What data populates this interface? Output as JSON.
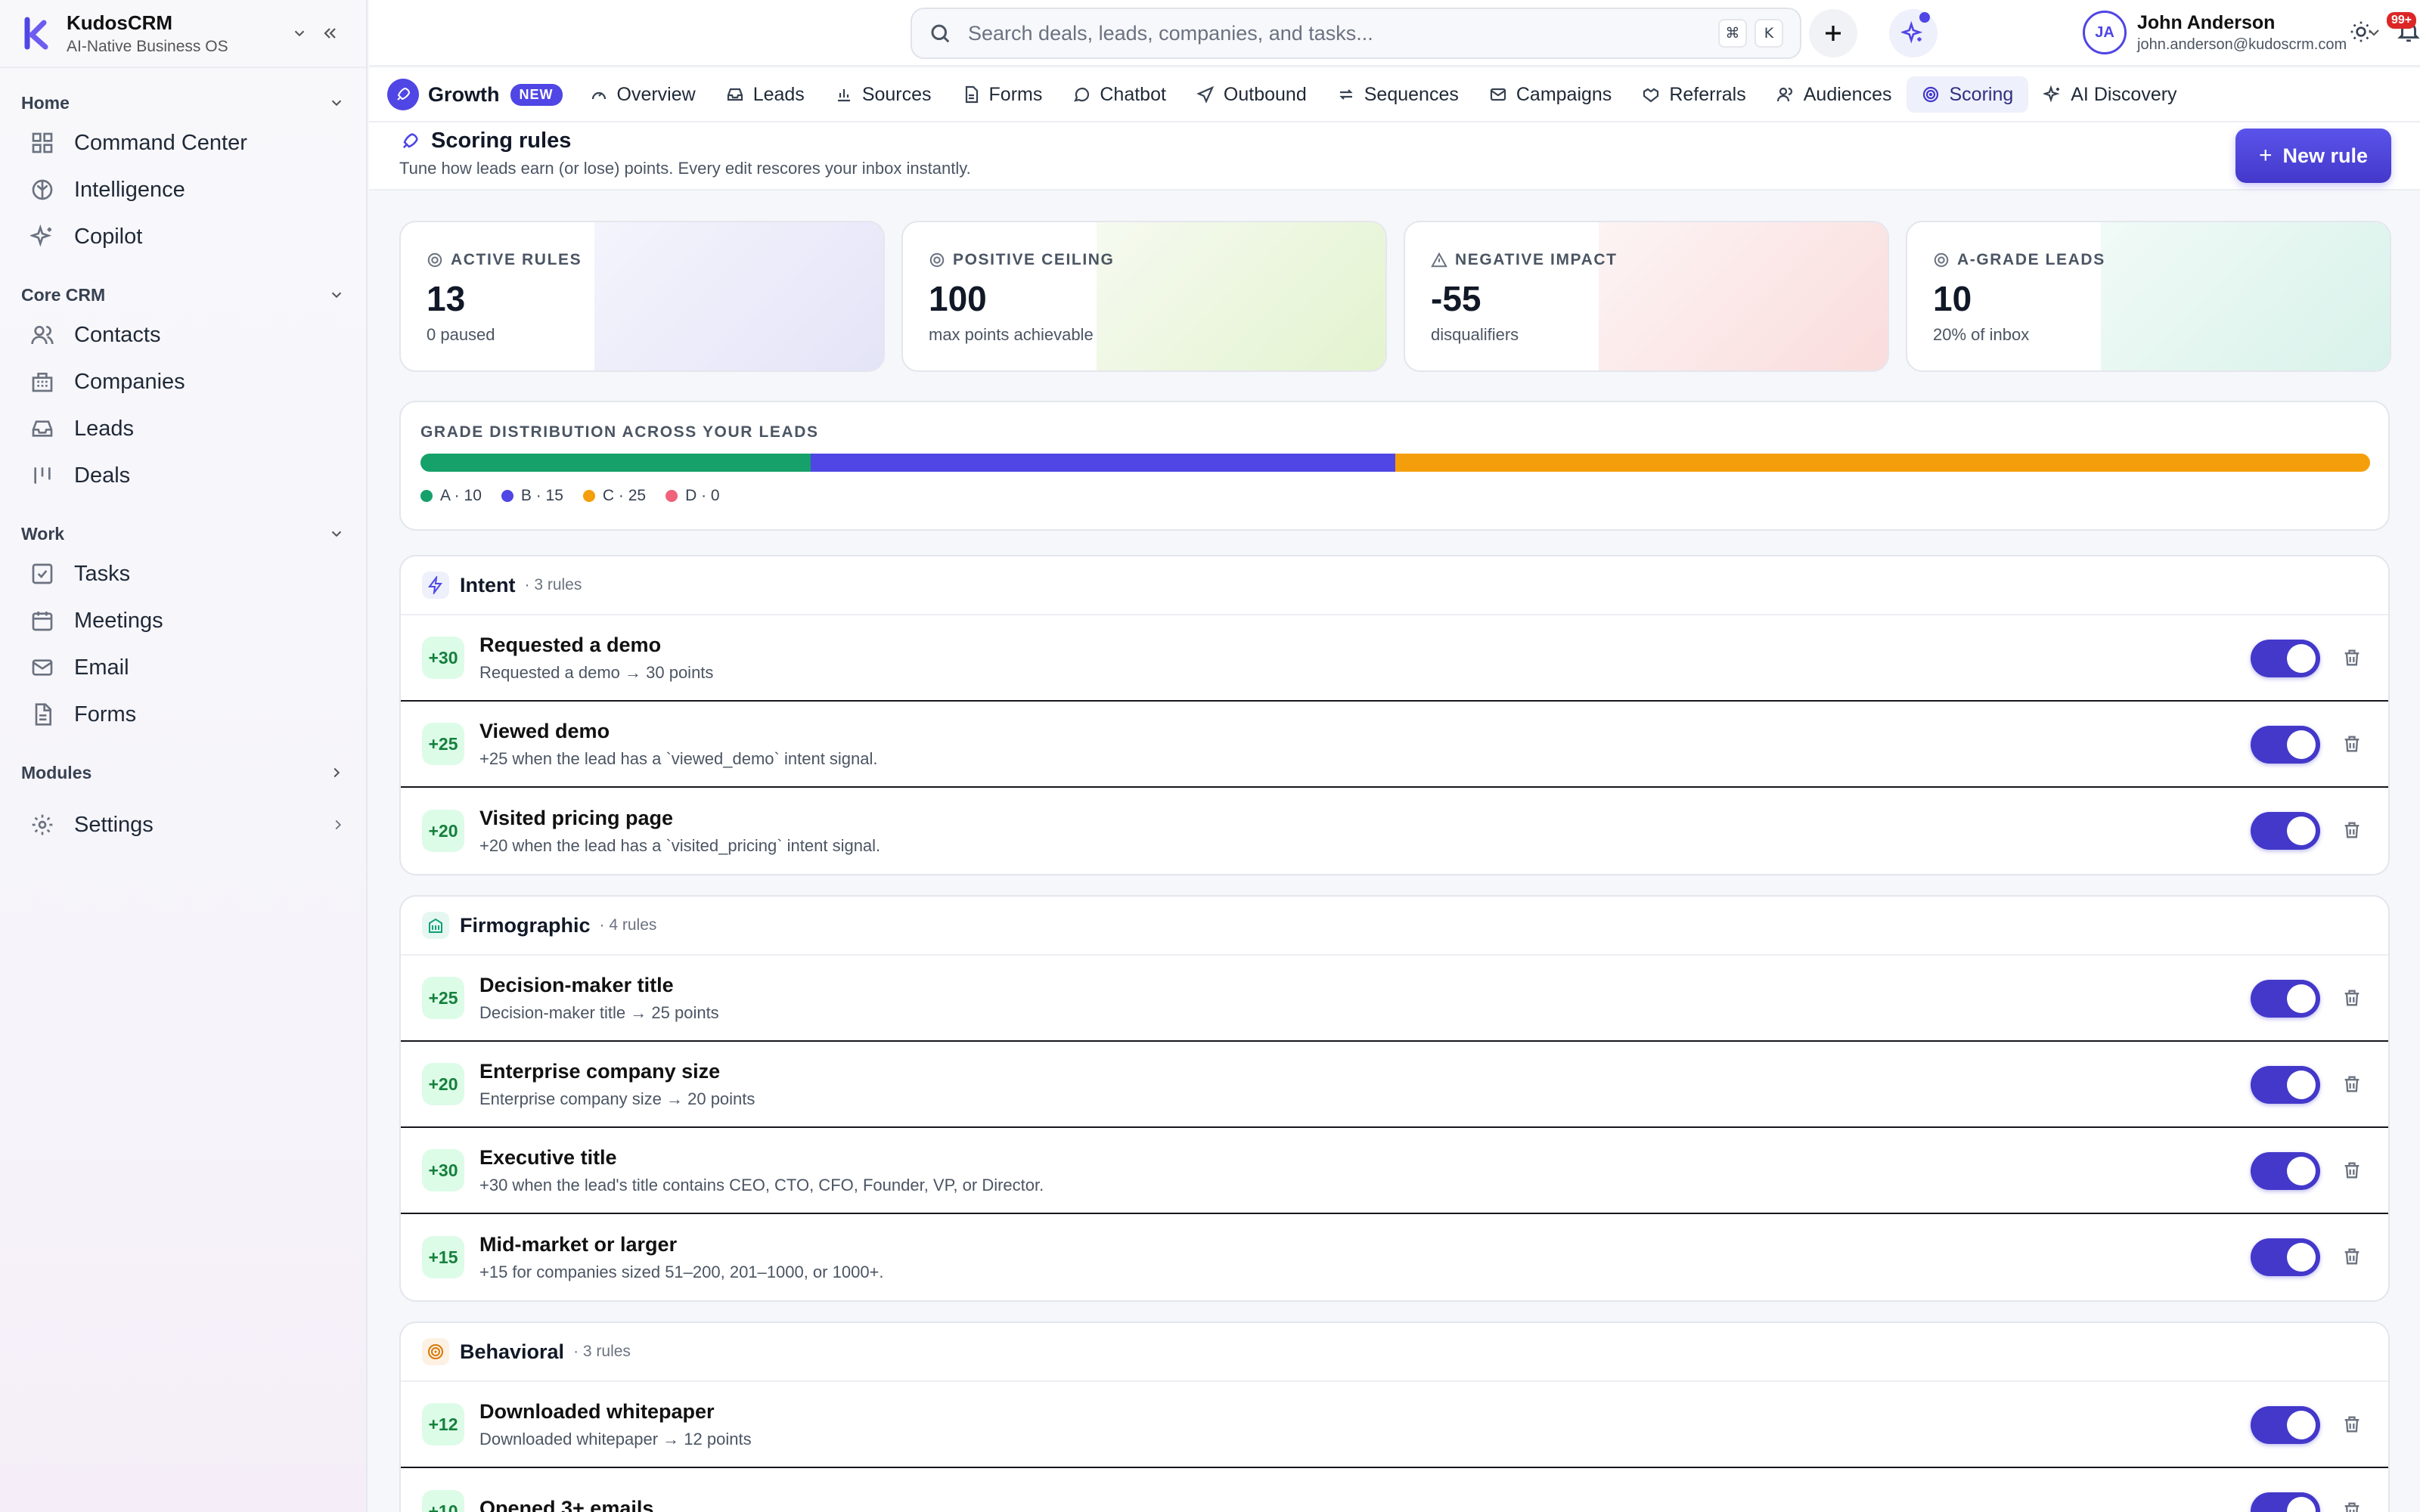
{
  "brand": {
    "name": "KudosCRM",
    "tagline": "AI-Native Business OS"
  },
  "sidebar": {
    "sections": [
      {
        "title": "Home",
        "items": [
          "Command Center",
          "Intelligence",
          "Copilot"
        ]
      },
      {
        "title": "Core CRM",
        "items": [
          "Contacts",
          "Companies",
          "Leads",
          "Deals"
        ]
      },
      {
        "title": "Work",
        "items": [
          "Tasks",
          "Meetings",
          "Email",
          "Forms"
        ]
      },
      {
        "title": "Modules",
        "items": []
      }
    ],
    "settings": "Settings"
  },
  "search": {
    "placeholder": "Search deals, leads, companies, and tasks...",
    "kbd1": "⌘",
    "kbd2": "K"
  },
  "notifications": {
    "badge": "99+"
  },
  "user": {
    "initials": "JA",
    "name": "John Anderson",
    "email": "john.anderson@kudoscrm.com"
  },
  "tabs": {
    "growth": "Growth",
    "new_badge": "NEW",
    "items": [
      "Overview",
      "Leads",
      "Sources",
      "Forms",
      "Chatbot",
      "Outbound",
      "Sequences",
      "Campaigns",
      "Referrals",
      "Audiences",
      "Scoring",
      "AI Discovery"
    ],
    "active": "Scoring"
  },
  "page": {
    "title": "Scoring rules",
    "subtitle": "Tune how leads earn (or lose) points. Every edit rescores your inbox instantly.",
    "new_rule": "New rule"
  },
  "stats": [
    {
      "label": "ACTIVE RULES",
      "value": "13",
      "sub": "0 paused"
    },
    {
      "label": "POSITIVE CEILING",
      "value": "100",
      "sub": "max points achievable"
    },
    {
      "label": "NEGATIVE IMPACT",
      "value": "-55",
      "sub": "disqualifiers"
    },
    {
      "label": "A-GRADE LEADS",
      "value": "10",
      "sub": "20% of inbox"
    }
  ],
  "distribution": {
    "title": "GRADE DISTRIBUTION ACROSS YOUR LEADS",
    "grades": [
      {
        "label": "A · 10",
        "count": 10,
        "color": "#16a06a"
      },
      {
        "label": "B · 15",
        "count": 15,
        "color": "#4f46e5"
      },
      {
        "label": "C · 25",
        "count": 25,
        "color": "#f59e0b"
      },
      {
        "label": "D · 0",
        "count": 0,
        "color": "#f0617a"
      }
    ]
  },
  "groups": [
    {
      "name": "Intent",
      "count": "· 3 rules",
      "rules": [
        {
          "points": "+30",
          "name": "Requested a demo",
          "desc": "Requested a demo → 30 points"
        },
        {
          "points": "+25",
          "name": "Viewed demo",
          "desc": "+25 when the lead has a `viewed_demo` intent signal."
        },
        {
          "points": "+20",
          "name": "Visited pricing page",
          "desc": "+20 when the lead has a `visited_pricing` intent signal."
        }
      ]
    },
    {
      "name": "Firmographic",
      "count": "· 4 rules",
      "rules": [
        {
          "points": "+25",
          "name": "Decision-maker title",
          "desc": "Decision-maker title → 25 points"
        },
        {
          "points": "+20",
          "name": "Enterprise company size",
          "desc": "Enterprise company size → 20 points"
        },
        {
          "points": "+30",
          "name": "Executive title",
          "desc": "+30 when the lead's title contains CEO, CTO, CFO, Founder, VP, or Director."
        },
        {
          "points": "+15",
          "name": "Mid-market or larger",
          "desc": "+15 for companies sized 51–200, 201–1000, or 1000+."
        }
      ]
    },
    {
      "name": "Behavioral",
      "count": "· 3 rules",
      "rules": [
        {
          "points": "+12",
          "name": "Downloaded whitepaper",
          "desc": "Downloaded whitepaper → 12 points"
        },
        {
          "points": "+10",
          "name": "Opened 3+ emails",
          "desc": ""
        }
      ]
    }
  ]
}
